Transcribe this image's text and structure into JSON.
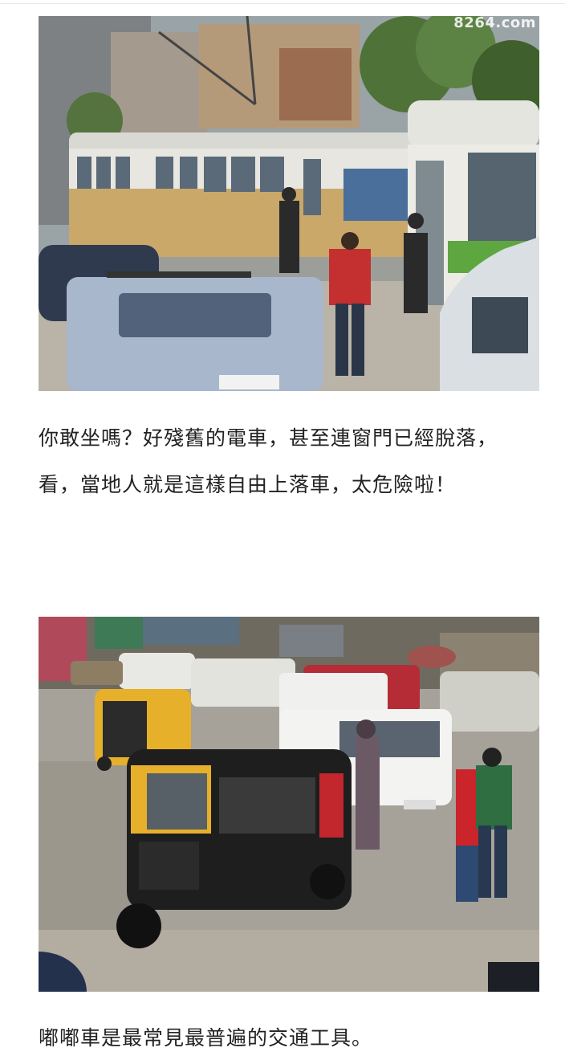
{
  "article": {
    "images": [
      {
        "watermark": "8264.com",
        "caption": "你敢坐嗎？好殘舊的電車，甚至連窗門已經脫落，看，當地人就是這樣自由上落車，太危險啦！"
      },
      {
        "caption": "嘟嘟車是最常見最普遍的交通工具。"
      }
    ]
  },
  "colors": {
    "text": "#222222",
    "background": "#ffffff",
    "tram_body": "#c9a86a",
    "tram_roof": "#d9d9d4",
    "tuktuk_yellow": "#e7b02a",
    "tuktuk_black": "#1e1e1e"
  }
}
